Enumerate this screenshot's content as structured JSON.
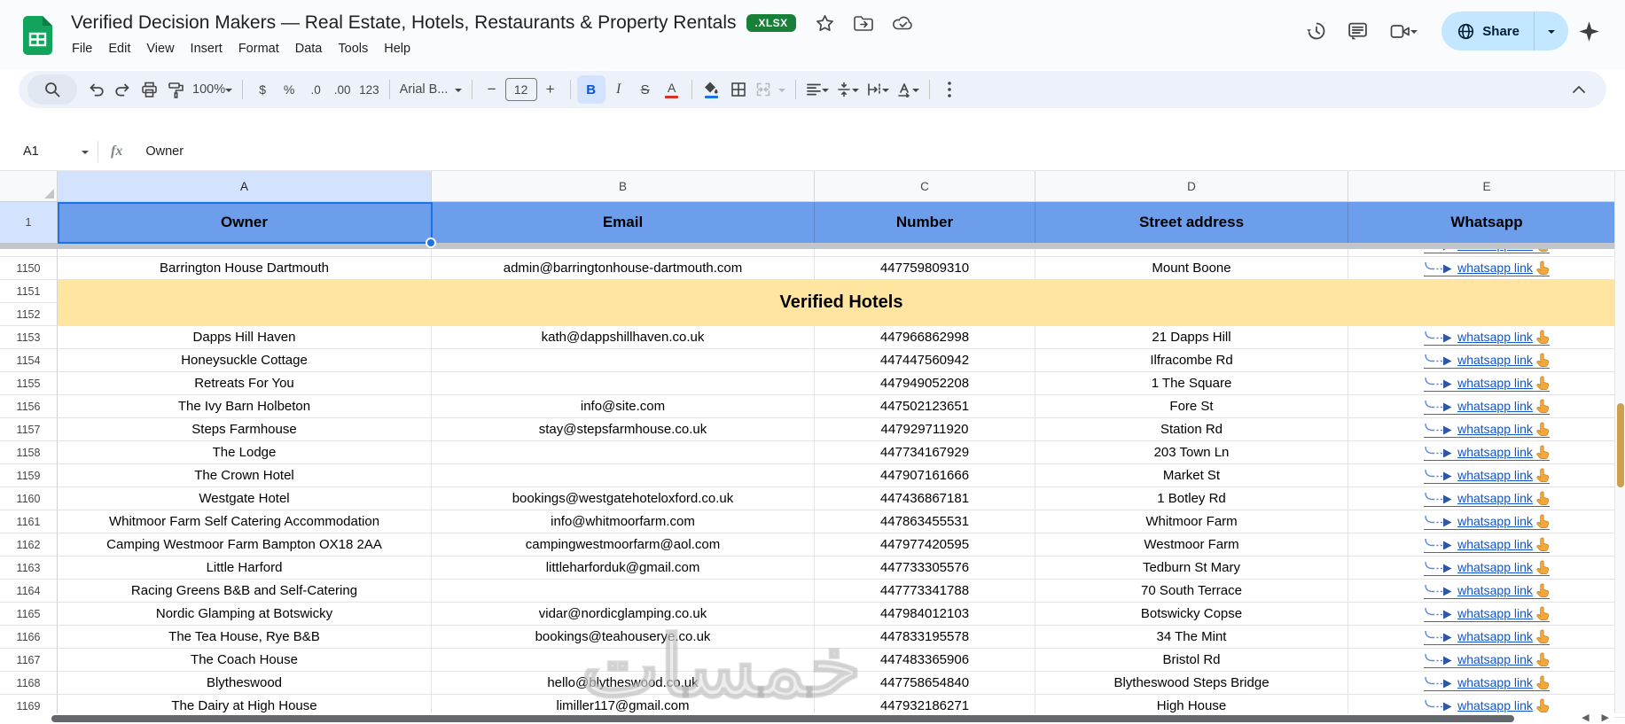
{
  "titlebar": {
    "title": "Verified Decision Makers — Real Estate, Hotels, Restaurants & Property Rentals",
    "badge": ".XLSX",
    "menu": [
      "File",
      "Edit",
      "View",
      "Insert",
      "Format",
      "Data",
      "Tools",
      "Help"
    ],
    "share_label": "Share"
  },
  "toolbar": {
    "zoom": "100%",
    "currency": "$",
    "percent": "%",
    "decrease_decimal": ".0",
    "increase_decimal": ".00",
    "more_formats": "123",
    "font": "Arial B...",
    "minus": "−",
    "font_size": "12",
    "plus": "+",
    "bold": "B",
    "italic": "I",
    "strikethrough": "S",
    "text_color": "A"
  },
  "formula_bar": {
    "cell_ref": "A1",
    "fx": "fx",
    "value": "Owner"
  },
  "sheet": {
    "column_letters": [
      "A",
      "B",
      "C",
      "D",
      "E"
    ],
    "header_row": {
      "n": "1",
      "owner": "Owner",
      "email": "Email",
      "number": "Number",
      "street": "Street address",
      "whatsapp": "Whatsapp"
    },
    "whatsapp_link_label": "whatsapp link",
    "watermark": "خمسات",
    "partial_row": {
      "whatsapp": true
    },
    "rows": [
      {
        "n": "1150",
        "owner": "Barrington House Dartmouth",
        "email": "admin@barringtonhouse-dartmouth.com",
        "number": "447759809310",
        "street": "Mount Boone",
        "whatsapp": true
      },
      {
        "band": true,
        "rows": [
          "1151",
          "1152"
        ],
        "label": "Verified Hotels"
      },
      {
        "n": "1153",
        "owner": "Dapps Hill Haven",
        "email": "kath@dappshillhaven.co.uk",
        "number": "447966862998",
        "street": "21 Dapps Hill",
        "whatsapp": true
      },
      {
        "n": "1154",
        "owner": "Honeysuckle Cottage",
        "email": "",
        "number": "447447560942",
        "street": "Ilfracombe Rd",
        "whatsapp": true
      },
      {
        "n": "1155",
        "owner": "Retreats For You",
        "email": "",
        "number": "447949052208",
        "street": "1 The Square",
        "whatsapp": true
      },
      {
        "n": "1156",
        "owner": "The Ivy Barn Holbeton",
        "email": "info@site.com",
        "number": "447502123651",
        "street": "Fore St",
        "whatsapp": true
      },
      {
        "n": "1157",
        "owner": "Steps Farmhouse",
        "email": "stay@stepsfarmhouse.co.uk",
        "number": "447929711920",
        "street": "Station Rd",
        "whatsapp": true
      },
      {
        "n": "1158",
        "owner": "The Lodge",
        "email": "",
        "number": "447734167929",
        "street": "203 Town Ln",
        "whatsapp": true
      },
      {
        "n": "1159",
        "owner": "The Crown Hotel",
        "email": "",
        "number": "447907161666",
        "street": "Market St",
        "whatsapp": true
      },
      {
        "n": "1160",
        "owner": "Westgate Hotel",
        "email": "bookings@westgatehoteloxford.co.uk",
        "number": "447436867181",
        "street": "1 Botley Rd",
        "whatsapp": true
      },
      {
        "n": "1161",
        "owner": "Whitmoor Farm Self Catering Accommodation",
        "email": "info@whitmoorfarm.com",
        "number": "447863455531",
        "street": "Whitmoor Farm",
        "whatsapp": true
      },
      {
        "n": "1162",
        "owner": "Camping Westmoor Farm Bampton OX18 2AA",
        "email": "campingwestmoorfarm@aol.com",
        "number": "447977420595",
        "street": "Westmoor Farm",
        "whatsapp": true
      },
      {
        "n": "1163",
        "owner": "Little Harford",
        "email": "littleharforduk@gmail.com",
        "number": "447733305576",
        "street": "Tedburn St Mary",
        "whatsapp": true
      },
      {
        "n": "1164",
        "owner": "Racing Greens B&B and Self-Catering",
        "email": "",
        "number": "447773341788",
        "street": "70 South Terrace",
        "whatsapp": true
      },
      {
        "n": "1165",
        "owner": "Nordic Glamping at Botswicky",
        "email": "vidar@nordicglamping.co.uk",
        "number": "447984012103",
        "street": "Botswicky Copse",
        "whatsapp": true
      },
      {
        "n": "1166",
        "owner": "The Tea House, Rye B&B",
        "email": "bookings@teahouserye.co.uk",
        "number": "447833195578",
        "street": "34 The Mint",
        "whatsapp": true
      },
      {
        "n": "1167",
        "owner": "The Coach House",
        "email": "",
        "number": "447483365906",
        "street": "Bristol Rd",
        "whatsapp": true
      },
      {
        "n": "1168",
        "owner": "Blytheswood",
        "email": "hello@blytheswood.co.uk",
        "number": "447758654840",
        "street": "Blytheswood Steps Bridge",
        "whatsapp": true
      },
      {
        "n": "1169",
        "owner": "The Dairy at High House",
        "email": "limiller117@gmail.com",
        "number": "447932186271",
        "street": "High House",
        "whatsapp": true
      }
    ]
  },
  "colors": {
    "header_row_blue": "#6d9eeb",
    "section_band_yellow": "#ffe5a0",
    "selection_blue": "#1a73e8",
    "link_blue": "#1155cc",
    "badge_green": "#188038",
    "share_pill": "#c2e7ff"
  }
}
